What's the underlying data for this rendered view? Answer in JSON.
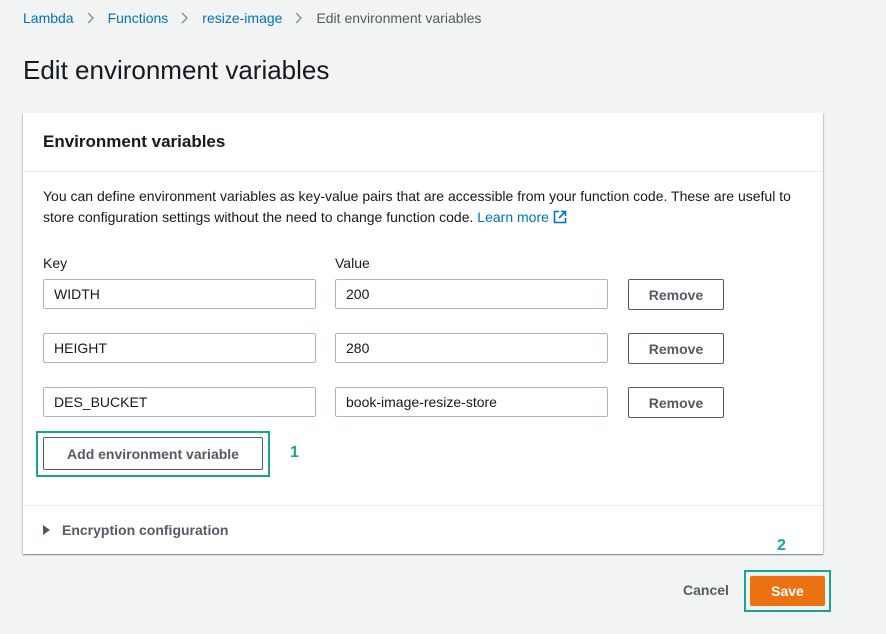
{
  "breadcrumb": {
    "items": [
      {
        "label": "Lambda"
      },
      {
        "label": "Functions"
      },
      {
        "label": "resize-image"
      }
    ],
    "current": "Edit environment variables"
  },
  "page": {
    "title": "Edit environment variables"
  },
  "panel": {
    "title": "Environment variables",
    "description": "You can define environment variables as key-value pairs that are accessible from your function code. These are useful to store configuration settings without the need to change function code.",
    "learn_more": "Learn more",
    "key_label": "Key",
    "value_label": "Value",
    "rows": [
      {
        "key": "WIDTH",
        "value": "200",
        "remove": "Remove"
      },
      {
        "key": "HEIGHT",
        "value": "280",
        "remove": "Remove"
      },
      {
        "key": "DES_BUCKET",
        "value": "book-image-resize-store",
        "remove": "Remove"
      }
    ],
    "add_button": "Add environment variable",
    "encryption_label": "Encryption configuration"
  },
  "annotations": {
    "one": "1",
    "two": "2"
  },
  "footer": {
    "cancel": "Cancel",
    "save": "Save"
  },
  "colors": {
    "link": "#0073bb",
    "primary": "#ec7211",
    "highlight": "#1aa394"
  }
}
